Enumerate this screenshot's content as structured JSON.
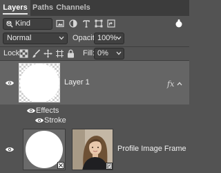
{
  "tabs": [
    {
      "label": "Layers",
      "active": true
    },
    {
      "label": "Paths",
      "active": false
    },
    {
      "label": "Channels",
      "active": false
    }
  ],
  "filter": {
    "kind_label": "Kind",
    "icons": [
      "search-icon",
      "image-filter-icon",
      "adjustment-filter-icon",
      "type-filter-icon",
      "shape-filter-icon",
      "smart-object-filter-icon",
      "filter-toggle"
    ]
  },
  "blend": {
    "mode": "Normal",
    "opacity_label": "Opacity:",
    "opacity_value": "100%"
  },
  "lock": {
    "label": "Lock:",
    "fill_label": "Fill:",
    "fill_value": "0%",
    "icons": [
      "lock-transparent-pixels-icon",
      "lock-image-pixels-icon",
      "lock-position-icon",
      "lock-artboard-icon",
      "lock-all-icon"
    ]
  },
  "layers": [
    {
      "name": "Layer 1",
      "selected": true,
      "visible": true,
      "fx": "fx",
      "effects_header": "Effects",
      "effects": [
        "Stroke"
      ]
    },
    {
      "name": "Profile Image Frame",
      "selected": false,
      "visible": true
    }
  ],
  "colors": {
    "panel_bg": "#535353",
    "tab_bar_bg": "#3c3c3c",
    "selected_row_bg": "#656565",
    "text": "#e6e6e6"
  }
}
